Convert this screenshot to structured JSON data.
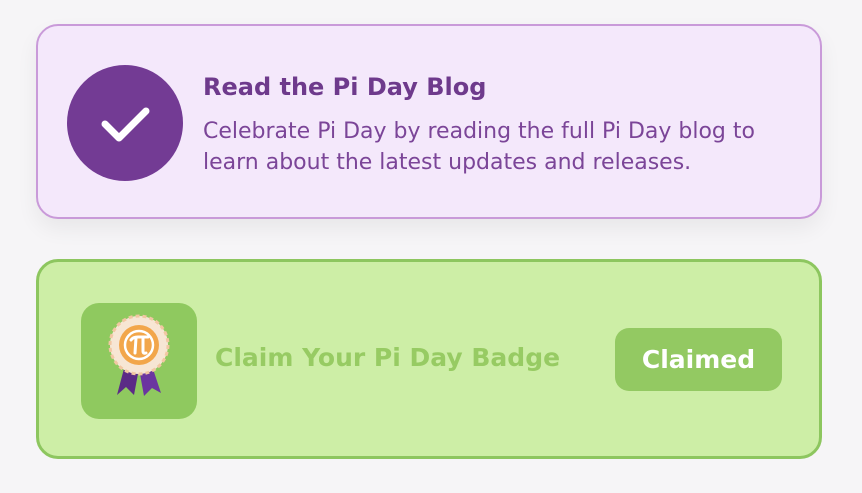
{
  "blog_task": {
    "title": "Read the Pi Day Blog",
    "description": "Celebrate Pi Day by reading the full Pi Day blog to learn about the latest updates and releases.",
    "completed": true,
    "icon": "check-icon"
  },
  "badge_task": {
    "label": "Claim Your Pi Day Badge",
    "button_label": "Claimed",
    "icon": "pi-badge-ribbon-icon"
  },
  "colors": {
    "purple_accent": "#733b94",
    "purple_card_bg": "#f4e8fb",
    "green_card_bg": "#cdeea6",
    "green_accent": "#93c962"
  }
}
